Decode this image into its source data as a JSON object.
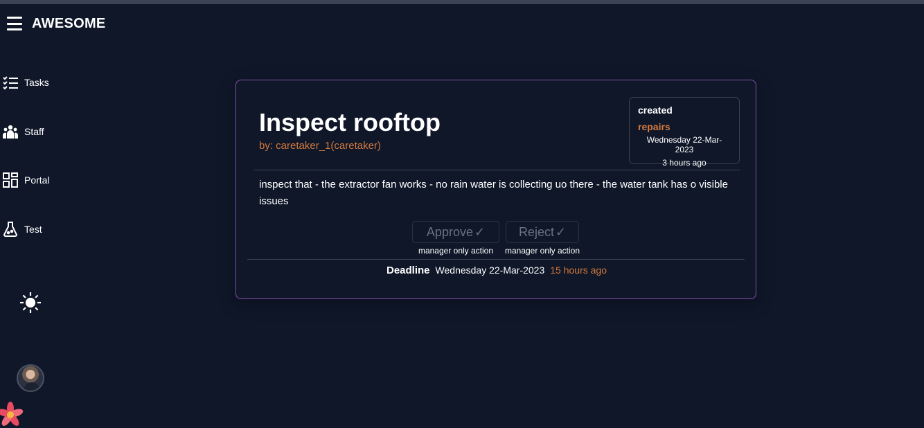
{
  "app": {
    "brand": "AWESOME"
  },
  "sidebar": {
    "items": [
      {
        "label": "Tasks",
        "icon": "tasks-icon"
      },
      {
        "label": "Staff",
        "icon": "staff-icon"
      },
      {
        "label": "Portal",
        "icon": "portal-icon"
      },
      {
        "label": "Test",
        "icon": "flask-icon"
      }
    ],
    "theme_icon": "sun-icon"
  },
  "task": {
    "title": "Inspect rooftop",
    "author": "by: caretaker_1(caretaker)",
    "status": {
      "label": "created",
      "category": "repairs",
      "date": "Wednesday 22-Mar-2023",
      "ago": "3 hours ago"
    },
    "description": "inspect that - the extractor fan works - no rain water is collecting uo there - the water tank has o visible issues",
    "actions": [
      {
        "label": "Approve",
        "check": "✓",
        "note": "manager only action"
      },
      {
        "label": "Reject",
        "check": "✓",
        "note": "manager only action"
      }
    ],
    "deadline": {
      "label": "Deadline",
      "date": "Wednesday 22-Mar-2023",
      "ago": "15 hours ago"
    }
  },
  "colors": {
    "background": "#0f1729",
    "accent": "#d47a3c",
    "card_border": "#8a4fb0"
  }
}
